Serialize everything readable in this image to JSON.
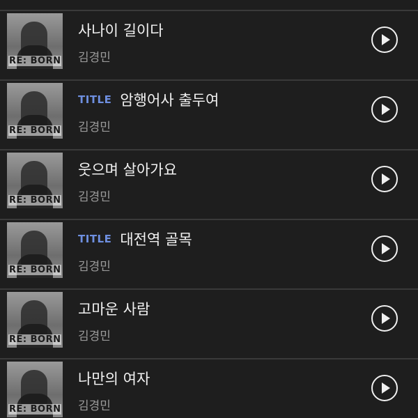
{
  "tracks": [
    {
      "title": "사나이 길이다",
      "artist": "김경민",
      "badge": "",
      "album_art_text": "RE: BORN"
    },
    {
      "title": "암행어사 출두여",
      "artist": "김경민",
      "badge": "TITLE",
      "album_art_text": "RE: BORN"
    },
    {
      "title": "웃으며 살아가요",
      "artist": "김경민",
      "badge": "",
      "album_art_text": "RE: BORN"
    },
    {
      "title": "대전역 골목",
      "artist": "김경민",
      "badge": "TITLE",
      "album_art_text": "RE: BORN"
    },
    {
      "title": "고마운 사람",
      "artist": "김경민",
      "badge": "",
      "album_art_text": "RE: BORN"
    },
    {
      "title": "나만의 여자",
      "artist": "김경민",
      "badge": "",
      "album_art_text": "RE: BORN"
    }
  ],
  "icons": {
    "play": "play-icon"
  },
  "colors": {
    "background": "#1e1e1e",
    "divider": "#3a3a3a",
    "title_badge": "#6e8fe0",
    "title_text": "#f2f2f2",
    "artist_text": "#9a9a9a"
  }
}
